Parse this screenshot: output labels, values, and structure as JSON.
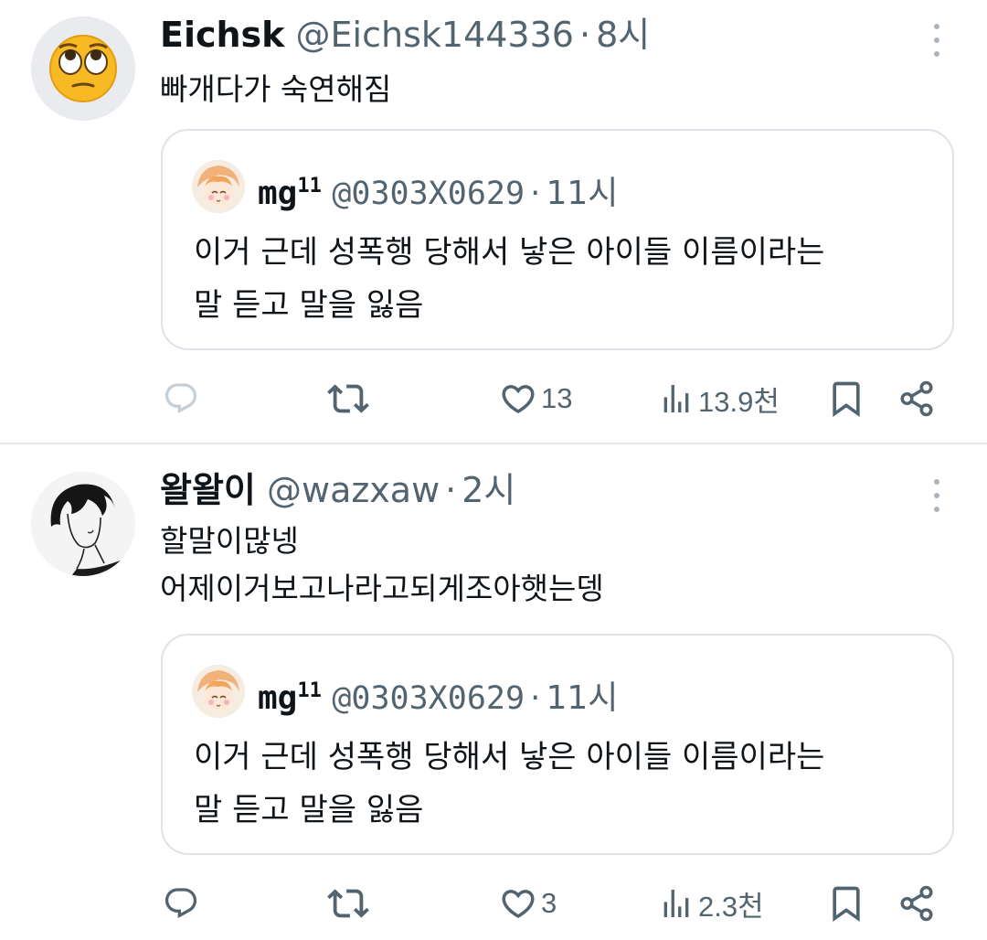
{
  "tweets": [
    {
      "name": "Eichsk",
      "handle": "@Eichsk144336",
      "dot": "·",
      "time": "8시",
      "lines": [
        "빠개다가 숙연해짐"
      ],
      "quote": {
        "name": "mg",
        "name_sup": "11",
        "handle": "@0303X0629",
        "dot": "·",
        "time": "11시",
        "lines": [
          "이거 근데 성폭행 당해서 낳은 아이들 이름이라는",
          "말 듣고 말을 잃음"
        ]
      },
      "likes": "13",
      "views": "13.9천",
      "icons": [
        "reply-icon",
        "retweet-icon",
        "heart-icon",
        "views-icon",
        "bookmark-icon",
        "share-icon"
      ]
    },
    {
      "name": "왈왈이",
      "handle": "@wazxaw",
      "dot": "·",
      "time": "2시",
      "lines": [
        "할말이많넹",
        "어제이거보고나라고되게조아햇는뎅"
      ],
      "quote": {
        "name": "mg",
        "name_sup": "11",
        "handle": "@0303X0629",
        "dot": "·",
        "time": "11시",
        "lines": [
          "이거 근데 성폭행 당해서 낳은 아이들 이름이라는",
          "말 듣고 말을 잃음"
        ]
      },
      "likes": "3",
      "views": "2.3천",
      "icons": [
        "reply-icon",
        "retweet-icon",
        "heart-icon",
        "views-icon",
        "bookmark-icon",
        "share-icon"
      ]
    }
  ],
  "colors": {
    "text": "#0f1419",
    "secondary": "#536471",
    "border": "#dde3e8",
    "emoji": "#f5b921"
  }
}
